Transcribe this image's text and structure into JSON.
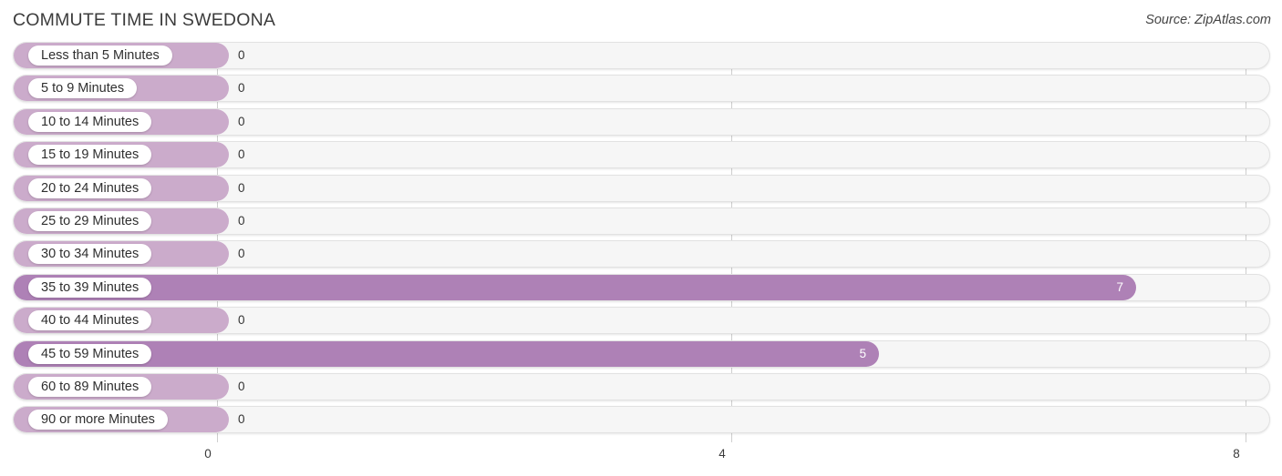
{
  "header": {
    "title": "COMMUTE TIME IN SWEDONA",
    "source": "Source: ZipAtlas.com"
  },
  "colors": {
    "bar_zero": "#cbabcb",
    "bar_value": "#ae81b6",
    "row_background": "#f6f6f6",
    "gridline": "#cfcfcf",
    "title_text": "#3c3c3c"
  },
  "chart_data": {
    "type": "bar",
    "orientation": "horizontal",
    "title": "COMMUTE TIME IN SWEDONA",
    "xlabel": "",
    "ylabel": "",
    "xlim": [
      0,
      8
    ],
    "xticks": [
      "0",
      "4",
      "8"
    ],
    "xtick_values": [
      0,
      4,
      8
    ],
    "grid": true,
    "legend": null,
    "categories": [
      "Less than 5 Minutes",
      "5 to 9 Minutes",
      "10 to 14 Minutes",
      "15 to 19 Minutes",
      "20 to 24 Minutes",
      "25 to 29 Minutes",
      "30 to 34 Minutes",
      "35 to 39 Minutes",
      "40 to 44 Minutes",
      "45 to 59 Minutes",
      "60 to 89 Minutes",
      "90 or more Minutes"
    ],
    "values": [
      0,
      0,
      0,
      0,
      0,
      0,
      0,
      7,
      0,
      5,
      0,
      0
    ],
    "value_labels": [
      "0",
      "0",
      "0",
      "0",
      "0",
      "0",
      "0",
      "7",
      "0",
      "5",
      "0",
      "0"
    ]
  },
  "rows": [
    {
      "label": "Less than 5 Minutes",
      "value": 0,
      "value_label": "0"
    },
    {
      "label": "5 to 9 Minutes",
      "value": 0,
      "value_label": "0"
    },
    {
      "label": "10 to 14 Minutes",
      "value": 0,
      "value_label": "0"
    },
    {
      "label": "15 to 19 Minutes",
      "value": 0,
      "value_label": "0"
    },
    {
      "label": "20 to 24 Minutes",
      "value": 0,
      "value_label": "0"
    },
    {
      "label": "25 to 29 Minutes",
      "value": 0,
      "value_label": "0"
    },
    {
      "label": "30 to 34 Minutes",
      "value": 0,
      "value_label": "0"
    },
    {
      "label": "35 to 39 Minutes",
      "value": 7,
      "value_label": "7"
    },
    {
      "label": "40 to 44 Minutes",
      "value": 0,
      "value_label": "0"
    },
    {
      "label": "45 to 59 Minutes",
      "value": 5,
      "value_label": "5"
    },
    {
      "label": "60 to 89 Minutes",
      "value": 0,
      "value_label": "0"
    },
    {
      "label": "90 or more Minutes",
      "value": 0,
      "value_label": "0"
    }
  ],
  "axis": {
    "ticks": [
      {
        "label": "0",
        "value": 0
      },
      {
        "label": "4",
        "value": 4
      },
      {
        "label": "8",
        "value": 8
      }
    ]
  }
}
